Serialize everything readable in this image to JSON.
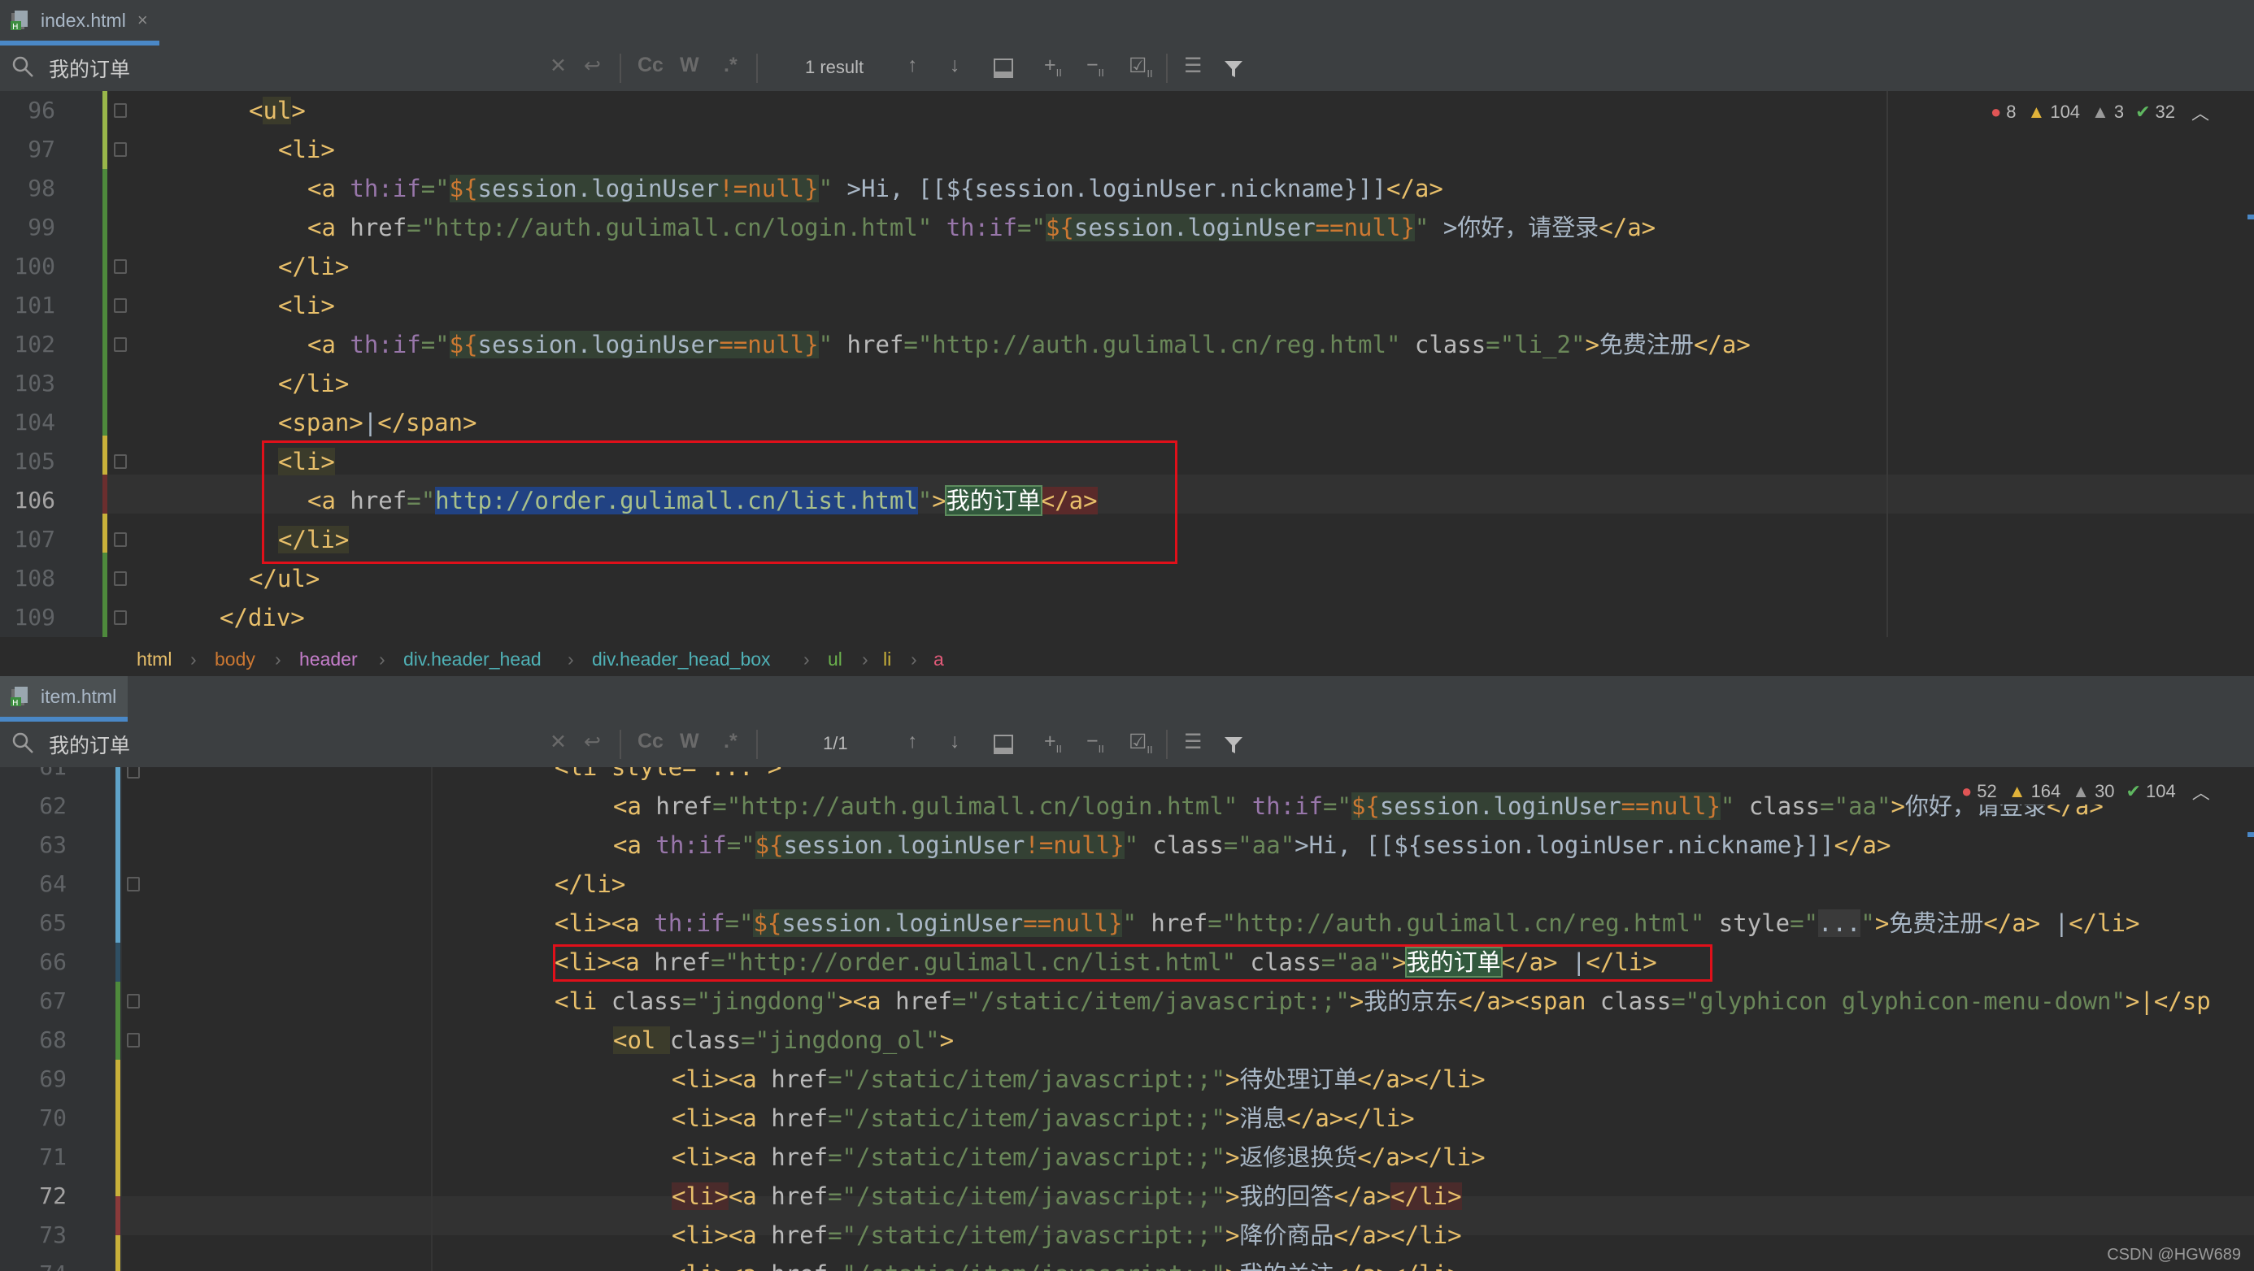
{
  "top": {
    "tab": {
      "label": "index.html",
      "close": "×"
    },
    "search": {
      "query": "我的订单",
      "case_label": "Cc",
      "word_label": "W",
      "regex_label": ".*",
      "result": "1 result"
    },
    "inspections": {
      "errors": "8",
      "warnings": "104",
      "weak_warnings": "3",
      "ok": "32"
    },
    "line_numbers": [
      "96",
      "97",
      "98",
      "99",
      "100",
      "101",
      "102",
      "103",
      "104",
      "105",
      "106",
      "107",
      "108",
      "109"
    ],
    "current_line": "106",
    "code": {
      "l96_open": "<",
      "l96_tag": "ul",
      "l96_close": ">",
      "l97": "<li>",
      "l98_a": "<a ",
      "l98_attr": "th:if",
      "l98_eq": "=\"",
      "l98_expr_open": "${",
      "l98_var": "session.loginUser",
      "l98_op": "!=null",
      "l98_expr_close": "}",
      "l98_q": "\"",
      "l98_rest": " >Hi, [[${session.loginUser.nickname}]]",
      "l98_end": "</a>",
      "l99_a": "<a ",
      "l99_href": "href",
      "l99_url": "=\"http://auth.gulimall.cn/login.html\"",
      "l99_attr": " th:if",
      "l99_eq": "=\"",
      "l99_expr_open": "${",
      "l99_var": "session.loginUser",
      "l99_op": "==null",
      "l99_expr_close": "}",
      "l99_q": "\"",
      "l99_rest": " >你好，请登录",
      "l99_end": "</a>",
      "l100": "</li>",
      "l101": "<li>",
      "l102_a": "<a ",
      "l102_attr": "th:if",
      "l102_eq": "=\"",
      "l102_expr_open": "${",
      "l102_var": "session.loginUser",
      "l102_op": "==null",
      "l102_expr_close": "}",
      "l102_q": "\"",
      "l102_href": " href",
      "l102_url": "=\"http://auth.gulimall.cn/reg.html\"",
      "l102_class": " class",
      "l102_cv": "=\"li_2\"",
      "l102_gt": ">",
      "l102_txt": "免费注册",
      "l102_end": "</a>",
      "l103": "</li>",
      "l104_open": "<span>",
      "l104_txt": "|",
      "l104_close": "</span>",
      "l105": "<li>",
      "l106_a": "<a ",
      "l106_href": "href",
      "l106_eq": "=\"",
      "l106_url": "http://order.gulimall.cn/list.html",
      "l106_q": "\"",
      "l106_gt": ">",
      "l106_match": "我的订单",
      "l106_end": "</a>",
      "l107": "</li>",
      "l108": "</ul>",
      "l109": "</div>"
    },
    "breadcrumb": [
      "html",
      "body",
      "header",
      "div.header_head",
      "div.header_head_box",
      "ul",
      "li",
      "a"
    ]
  },
  "bottom": {
    "tab": {
      "label": "item.html"
    },
    "search": {
      "query": "我的订单",
      "case_label": "Cc",
      "word_label": "W",
      "regex_label": ".*",
      "result": "1/1"
    },
    "inspections": {
      "errors": "52",
      "warnings": "164",
      "weak_warnings": "30",
      "ok": "104"
    },
    "line_numbers": [
      "61",
      "62",
      "63",
      "64",
      "65",
      "66",
      "67",
      "68",
      "69",
      "70",
      "71",
      "72",
      "73",
      "74"
    ],
    "current_line": "72",
    "code": {
      "l61": "<li style=\"...\">",
      "l62_a": "<a ",
      "l62_href": "href",
      "l62_url": "=\"http://auth.gulimall.cn/login.html\"",
      "l62_attr": " th:if",
      "l62_eq": "=\"",
      "l62_expr_open": "${",
      "l62_var": "session.loginUser",
      "l62_op": "==null",
      "l62_expr_close": "}",
      "l62_q": "\"",
      "l62_class": " class",
      "l62_cv": "=\"aa\"",
      "l62_gt": ">",
      "l62_txt": "你好，请登录",
      "l62_end": "</a>",
      "l63_a": "<a ",
      "l63_attr": "th:if",
      "l63_eq": "=\"",
      "l63_expr_open": "${",
      "l63_var": "session.loginUser",
      "l63_op": "!=null",
      "l63_expr_close": "}",
      "l63_q": "\"",
      "l63_class": " class",
      "l63_cv": "=\"aa\"",
      "l63_rest": ">Hi, [[${session.loginUser.nickname}]]",
      "l63_end": "</a>",
      "l64": "</li>",
      "l65_li": "<li>",
      "l65_a": "<a ",
      "l65_attr": "th:if",
      "l65_eq": "=\"",
      "l65_expr_open": "${",
      "l65_var": "session.loginUser",
      "l65_op": "==null",
      "l65_expr_close": "}",
      "l65_q": "\"",
      "l65_href": " href",
      "l65_url": "=\"http://auth.gulimall.cn/reg.html\"",
      "l65_style": " style",
      "l65_sv1": "=\"",
      "l65_dots": "...",
      "l65_sv2": "\"",
      "l65_gt": ">",
      "l65_txt": "免费注册",
      "l65_end": "</a>",
      "l65_pipe": " |",
      "l65_endli": "</li>",
      "l66_li": "<li>",
      "l66_a": "<a ",
      "l66_href": "href",
      "l66_url": "=\"http://order.gulimall.cn/list.html\"",
      "l66_class": " class",
      "l66_cv": "=\"aa\"",
      "l66_gt": ">",
      "l66_match": "我的订单",
      "l66_end": "</a>",
      "l66_pipe": " |",
      "l66_endli": "</li>",
      "l67_li": "<li ",
      "l67_class": "class",
      "l67_cv": "=\"jingdong\"",
      "l67_gt": ">",
      "l67_a": "<a ",
      "l67_href": "href",
      "l67_url": "=\"/static/item/javascript:;\"",
      "l67_gt2": ">",
      "l67_txt": "我的京东",
      "l67_end": "</a>",
      "l67_span": "<span ",
      "l67_class2": "class",
      "l67_cv2": "=\"glyphicon glyphicon-menu-down\"",
      "l67_tail": ">|</sp",
      "l68_ol": "<ol ",
      "l68_class": "class",
      "l68_cv": "=\"jingdong_ol\"",
      "l68_gt": ">",
      "l69_li": "<li><a ",
      "l69_href": "href",
      "l69_url": "=\"/static/item/javascript:;\"",
      "l69_gt": ">",
      "l69_txt": "待处理订单",
      "l69_end": "</a></li>",
      "l70_li": "<li><a ",
      "l70_href": "href",
      "l70_url": "=\"/static/item/javascript:;\"",
      "l70_gt": ">",
      "l70_txt": "消息",
      "l70_end": "</a></li>",
      "l71_li": "<li><a ",
      "l71_href": "href",
      "l71_url": "=\"/static/item/javascript:;\"",
      "l71_gt": ">",
      "l71_txt": "返修退换货",
      "l71_end": "</a></li>",
      "l72_li": "<li>",
      "l72_a": "<a ",
      "l72_href": "href",
      "l72_url": "=\"/static/item/javascript:;\"",
      "l72_gt": ">",
      "l72_txt": "我的回答",
      "l72_end": "</a>",
      "l72_endli": "</li>",
      "l73_li": "<li><a ",
      "l73_href": "href",
      "l73_url": "=\"/static/item/javascript:;\"",
      "l73_gt": ">",
      "l73_txt": "降价商品",
      "l73_end": "</a></li>",
      "l74_li": "<li><a ",
      "l74_href": "href",
      "l74_url": "=\"/static/item/javascript:;\"",
      "l74_gt": ">",
      "l74_txt": "我的关注",
      "l74_end": "</a></li>"
    }
  },
  "watermark": "CSDN @HGW689",
  "colors": {
    "tag": "#e8bf6a",
    "string": "#6a8759",
    "expression": "#cc7832",
    "variable": "#9876aa",
    "match_highlight": "#32593d",
    "selection": "#214283",
    "annotation_box": "#e0101a",
    "tab_underline": "#4a88c7"
  },
  "icons": [
    "html-file-icon",
    "close-icon",
    "search-icon",
    "clear-icon",
    "replace-icon",
    "arrow-up-icon",
    "arrow-down-icon",
    "open-in-window-icon",
    "add-selection-icon",
    "remove-selection-icon",
    "select-all-icon",
    "multiline-icon",
    "filter-icon",
    "error-icon",
    "warning-icon",
    "weak-warning-icon",
    "check-icon",
    "chevron-up-icon"
  ]
}
